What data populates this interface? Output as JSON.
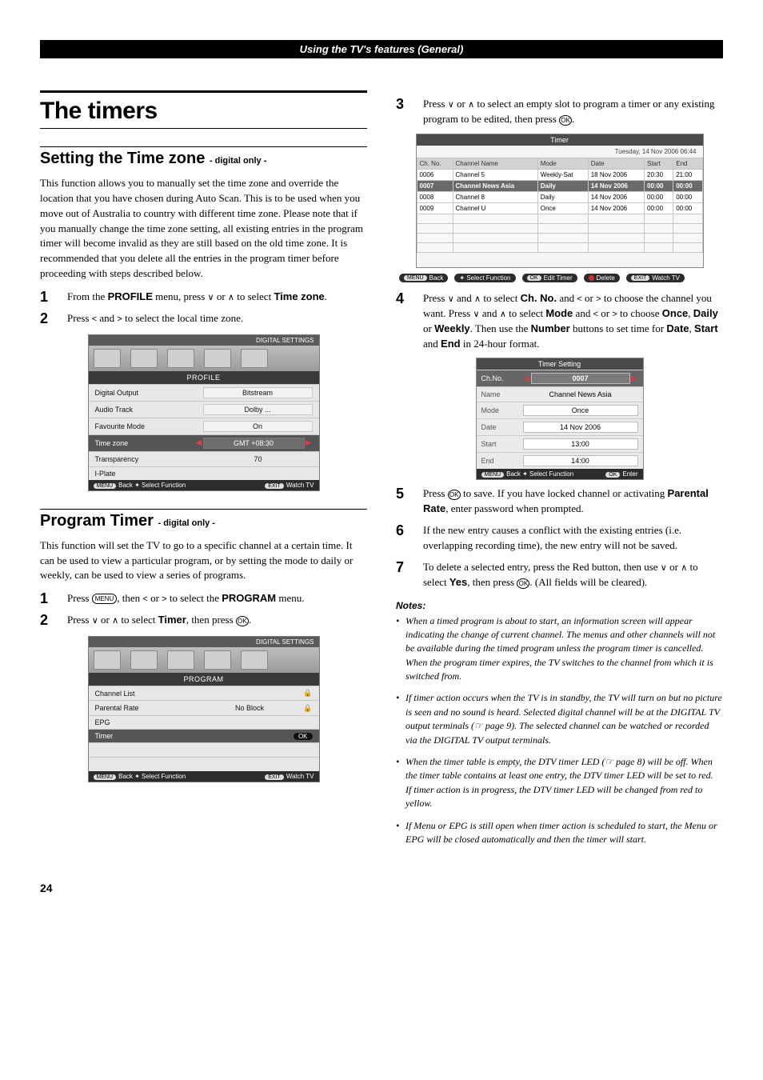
{
  "header": {
    "title": "Using the TV's features (General)"
  },
  "page_number": "24",
  "left": {
    "h1": "The timers",
    "sec1": {
      "title": "Setting the Time zone ",
      "subtitle": "- digital only -",
      "para": "This function allows you to manually set the time zone and override the location that you have chosen during Auto Scan. This is to be used when you move out of Australia to country with different time zone. Please note that if you manually change the time zone setting, all existing entries in the program timer will become invalid as they are still based on the old time zone. It is recommended that you delete all the entries in the program timer before proceeding with steps described below."
    },
    "steps1": [
      {
        "n": "1",
        "pre": "From the ",
        "b1": "PROFILE",
        "mid": " menu, press ",
        "g1": "∨",
        "mid2": " or ",
        "g2": "∧",
        "mid3": " to select ",
        "b2": "Time zone",
        "post": "."
      },
      {
        "n": "2",
        "pre": "Press ",
        "g1": "<",
        "mid": " and ",
        "g2": ">",
        "post": " to select the local time zone."
      }
    ],
    "osd_profile": {
      "topstrip": "DIGITAL SETTINGS",
      "title": "PROFILE",
      "rows": [
        {
          "label": "Digital Output",
          "value": "Bitstream"
        },
        {
          "label": "Audio Track",
          "value": "Dolby ..."
        },
        {
          "label": "Favourite Mode",
          "value": "On"
        },
        {
          "label": "Time zone",
          "value": "GMT +08:30",
          "sel": true,
          "arrows": true
        },
        {
          "label": "Transparency",
          "value": "70"
        },
        {
          "label": "I-Plate",
          "value": ""
        }
      ],
      "foot_left_btn": "MENU",
      "foot_left_text": "Back ✦ Select Function",
      "foot_right_btn": "EXIT",
      "foot_right_text": "Watch TV"
    },
    "sec2": {
      "title": "Program Timer ",
      "subtitle": "- digital only -",
      "para": "This function will set the TV to go to a specific channel at a certain time. It can be used to view a particular program, or by setting the mode to daily or weekly, can be used to view a series of programs."
    },
    "steps2": [
      {
        "n": "1",
        "pre": "Press ",
        "ovl": "MENU",
        "mid": ", then ",
        "g1": "<",
        "mid2": " or ",
        "g2": ">",
        "mid3": " to select the ",
        "b1": "PROGRAM",
        "post": " menu."
      },
      {
        "n": "2",
        "pre": "Press ",
        "g1": "∨",
        "mid": " or ",
        "g2": "∧",
        "mid2": " to select ",
        "b1": "Timer",
        "mid3": ", then press ",
        "circ": "OK",
        "post": "."
      }
    ],
    "osd_program": {
      "topstrip": "DIGITAL SETTINGS",
      "title": "PROGRAM",
      "rows": [
        {
          "label": "Channel List",
          "value": "",
          "lock": true
        },
        {
          "label": "Parental Rate",
          "value": "No Block",
          "lock": true
        },
        {
          "label": "EPG",
          "value": ""
        },
        {
          "label": "Timer",
          "value": "OK",
          "sel": true,
          "ok": true
        }
      ],
      "foot_left_btn": "MENU",
      "foot_left_text": "Back ✦ Select Function",
      "foot_right_btn": "EXIT",
      "foot_right_text": "Watch TV"
    }
  },
  "right": {
    "step3": {
      "n": "3",
      "pre": "Press ",
      "g1": "∨",
      "mid": " or ",
      "g2": "∧",
      "mid2": " to select an empty slot to program a timer or any existing program to be edited, then press ",
      "circ": "OK",
      "post": "."
    },
    "timer_table": {
      "head": "Timer",
      "date": "Tuesday, 14 Nov 2006   06:44",
      "cols": [
        "Ch. No.",
        "Channel Name",
        "Mode",
        "Date",
        "Start",
        "End"
      ],
      "rows": [
        {
          "ch": "0006",
          "name": "Channel 5",
          "mode": "Weekly-Sat",
          "date": "18 Nov 2006",
          "start": "20:30",
          "end": "21:00"
        },
        {
          "ch": "0007",
          "name": "Channel News Asia",
          "mode": "Daily",
          "date": "14 Nov 2006",
          "start": "00:00",
          "end": "00:00",
          "sel": true
        },
        {
          "ch": "0008",
          "name": "Channel 8",
          "mode": "Daily",
          "date": "14 Nov 2006",
          "start": "00:00",
          "end": "00:00"
        },
        {
          "ch": "0009",
          "name": "Channel U",
          "mode": "Once",
          "date": "14 Nov 2006",
          "start": "00:00",
          "end": "00:00"
        }
      ],
      "foot": {
        "menu_btn": "MENU",
        "menu_text": "Back",
        "sel_text": "✦ Select Function",
        "ok_btn": "OK",
        "ok_text": "Edit Timer",
        "del_text": "Delete",
        "exit_btn": "EXIT",
        "exit_text": "Watch TV"
      }
    },
    "step4": {
      "n": "4",
      "pre": "Press ",
      "g1": "∨",
      "mid1": " and ",
      "g2": "∧",
      "mid2": " to select ",
      "b1": "Ch. No.",
      "mid3": " and ",
      "g3": "<",
      "mid4": " or ",
      "g4": ">",
      "mid5": " to choose the channel you want. Press ",
      "g5": "∨",
      "mid6": " and ",
      "g6": "∧",
      "mid7": " to select ",
      "b2": "Mode",
      "mid8": " and ",
      "g7": "<",
      "mid9": " or ",
      "g8": ">",
      "mid10": " to choose ",
      "b3": "Once",
      "mid11": ", ",
      "b4": "Daily",
      "mid12": " or ",
      "b5": "Weekly",
      "mid13": ". Then use the ",
      "b6": "Number",
      "mid14": " buttons to set time for ",
      "b7": "Date",
      "mid15": ", ",
      "b8": "Start",
      "mid16": " and ",
      "b9": "End",
      "post": " in 24-hour format."
    },
    "setting_panel": {
      "head": "Timer Setting",
      "rows": [
        {
          "l": "Ch.No.",
          "v": "0007",
          "sel": true,
          "arrows": true
        },
        {
          "l": "Name",
          "v": "Channel News Asia"
        },
        {
          "l": "Mode",
          "v": "Once"
        },
        {
          "l": "Date",
          "v": "14 Nov 2006"
        },
        {
          "l": "Start",
          "v": "13:00"
        },
        {
          "l": "End",
          "v": "14:00"
        }
      ],
      "foot_left_btn": "MENU",
      "foot_left_text": "Back  ✦ Select Function",
      "foot_right_btn": "OK",
      "foot_right_text": "Enter"
    },
    "step5": {
      "n": "5",
      "pre": "Press ",
      "circ": "OK",
      "mid": " to save. If you have locked channel or activating ",
      "b1": "Parental Rate",
      "post": ", enter password when prompted."
    },
    "step6": {
      "n": "6",
      "text": "If the new entry causes a conflict with the existing entries (i.e. overlapping recording time), the new entry will not be saved."
    },
    "step7": {
      "n": "7",
      "pre": "To delete a selected entry, press the Red button, then use ",
      "g1": "∨",
      "mid": " or ",
      "g2": "∧",
      "mid2": " to select ",
      "b1": "Yes",
      "mid3": ", then press ",
      "circ": "OK",
      "post": ". (All fields will be cleared)."
    },
    "notes_head": "Notes:",
    "notes": [
      "When a timed program is about to start, an information screen will appear indicating the change of current channel. The menus and other channels will not be available during the timed program unless the program timer is cancelled. When the program timer expires, the TV switches to the channel from which it is switched from.",
      "If timer action occurs when the TV is in standby, the TV will turn on but no picture is seen and no sound is heard. Selected digital channel will be at the DIGITAL TV output terminals (☞ page 9). The selected channel can be watched or recorded via the DIGITAL TV output terminals.",
      "When the timer table is empty, the DTV timer LED (☞ page 8) will be off. When the timer table contains at least one entry, the DTV timer LED will be set to red.\nIf timer action is in progress, the DTV timer LED will be changed from red to yellow.",
      "If Menu or EPG is still open when timer action is scheduled to start, the Menu or EPG will be closed automatically and then the timer will start."
    ]
  }
}
